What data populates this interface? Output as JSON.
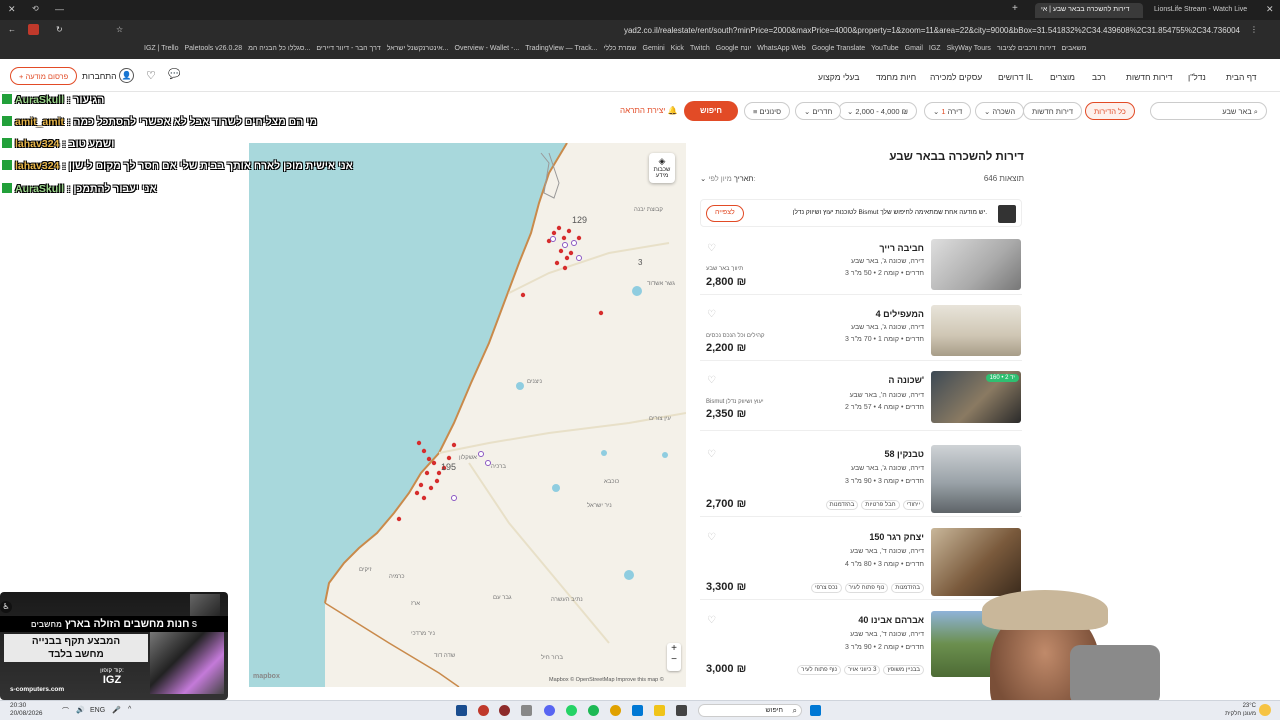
{
  "browser": {
    "tabs": [
      {
        "label": "דירות להשכרה בבאר שבע | אי"
      },
      {
        "label": "LionsLife Stream - Watch Live"
      }
    ],
    "url": "yad2.co.il/realestate/rent/south?minPrice=2000&maxPrice=4000&property=1&zoom=11&area=22&city=9000&bBox=31.541832%2C34.439608%2C31.854755%2C34.736004",
    "bookmarks": [
      "IGZ | Trello",
      "Paletools v26.0.28",
      "סגללו כל הבניה המ...",
      "דרך הבר - דיוור דיירים",
      "אינטרנקשנל ישראל...",
      "Overview - Wallet -...",
      "TradingView — Track...",
      "שמרת כללי",
      "Gemini",
      "Kick",
      "Twitch",
      "Google יונח",
      "WhatsApp Web",
      "Google Translate",
      "YouTube",
      "Gmail",
      "IGZ",
      "SkyWay Tours",
      "דירות ורכבים לציבור",
      "משאבים"
    ]
  },
  "header": {
    "post_ad": "+ פרסום מודעה",
    "login": "התחברות",
    "nav": [
      "דף הבית",
      "נדל\"ן",
      "דירות חדשות",
      "רכב",
      "מוצרים",
      "דרושים IL",
      "עסקים למכירה",
      "חיות מחמד",
      "בעלי מקצוע"
    ]
  },
  "filters": {
    "search_value": "באר שבע",
    "all_apartments": "כל הדירות",
    "new_apartments": "דירות חדשות",
    "rent": "השכרה",
    "property": "דירה",
    "property_count": "1",
    "price": "2,000 - 4,000 ₪",
    "rooms": "חדרים",
    "advanced": "סינונים",
    "search_button": "חיפוש",
    "create_alert": "יצירת התראה"
  },
  "map": {
    "layers_label": "שכבות מידע",
    "attribution": "Mapbox © OpenStreetMap Improve this map ©",
    "logo": "mapbox",
    "zoom_in": "+",
    "zoom_out": "−",
    "place_labels": [
      "קבוצת יבנה",
      "גשר אשדוד",
      "ניצנים",
      "עין צורים",
      "אשקלון",
      "ברכיה",
      "כוכבא",
      "ניר ישראל",
      "זיקים",
      "כרמיה",
      "נתיב העשרה",
      "ארז",
      "גבר עם",
      "ניר מרדכי",
      "שדה דוד",
      "ברור חיל"
    ],
    "cluster_labels": [
      "129",
      "195",
      "3"
    ]
  },
  "results": {
    "title": "דירות להשכרה בבאר שבע",
    "count": "646 תוצאות",
    "sort_label": "מיון לפי:",
    "sort_value": "תאריך",
    "promo_text": "לטוכנות יעוץ ושיווק נדלן Bismut יש מודעה אחת שמתאימה לחיפוש שלך.",
    "promo_button": "לצפייה",
    "listings": [
      {
        "title": "חביבה רייך",
        "sub": "דירה, שכונה ג', באר שבע",
        "details": "3 חדרים • קומה 2 • 50 מ\"ר",
        "price": "2,800 ₪",
        "agency": "תיווך באר שבע",
        "badge": "",
        "tags": []
      },
      {
        "title": "המעפילים 4",
        "sub": "דירה, שכונה ג', באר שבע",
        "details": "3 חדרים • קומה 1 • 70 מ\"ר",
        "price": "2,200 ₪",
        "agency": "קהילים וכל הנכס נכסים",
        "badge": "",
        "tags": []
      },
      {
        "title": "שכונה ה'",
        "sub": "דירה, שכונה ה', באר שבע",
        "details": "2 חדרים • קומה 4 • 57 מ\"ר",
        "price": "2,350 ₪",
        "agency": "Bismut יעוץ ושיווק נדלן",
        "badge": "יד 2 • 160",
        "tags": []
      },
      {
        "title": "טבנקין 58",
        "sub": "דירה, שכונה ג', באר שבע",
        "details": "3 חדרים • קומה 3 • 90 מ\"ר",
        "price": "2,700 ₪",
        "agency": "",
        "badge": "",
        "tags": [
          "בהזדמנות",
          "חבל פרטיות",
          "ייחודי"
        ]
      },
      {
        "title": "יצחק רגר 150",
        "sub": "דירה, שכונה ד', באר שבע",
        "details": "4 חדרים • קומה 3 • 80 מ\"ר",
        "price": "3,300 ₪",
        "agency": "",
        "badge": "",
        "tags": [
          "נכס צרפי",
          "נוף פתוח לעיר",
          "בהזדמנות"
        ]
      },
      {
        "title": "אברהם אבינו 40",
        "sub": "דירה, שכונה ד', באר שבע",
        "details": "3 חדרים • קומה 2 • 90 מ\"ר",
        "price": "3,000 ₪",
        "agency": "",
        "badge": "",
        "tags": [
          "נוף פתוח לעיר",
          "3 כיווני אויר",
          "בבניין משופץ"
        ]
      }
    ]
  },
  "chat": [
    {
      "user": "AuraSkull",
      "text": "הגיעור",
      "color": "#9ad48a"
    },
    {
      "user": "amit_amit",
      "text": "מי הם מצליחים לשרוד אבל לא אפשרי להסתכל כמה",
      "color": "#e8b64a"
    },
    {
      "user": "lahav324",
      "text": "ושמע טוב",
      "color": "#e8b64a"
    },
    {
      "user": "lahav324",
      "text": "אני אישית מוכן לארח אותך בבית שלי אם חסר לך מקום לישון",
      "color": "#e8b64a"
    },
    {
      "user": "AuraSkull",
      "text": "אני יעבור להתמכן",
      "color": "#9ad48a"
    }
  ],
  "ad": {
    "headline": "חנות מחשבים הזולה בארץ",
    "brand": "מחשבים S",
    "line1": "המבצע תקף בבנייה",
    "line2": "מחשב בלבד",
    "coupon_label": "קוד קופון:",
    "coupon_code": "IGZ",
    "site": "s-computers.com"
  },
  "taskbar": {
    "time": "20:30",
    "date": "20/08/2026",
    "lang": "ENG",
    "search": "חיפוש",
    "weather_temp": "23°C",
    "weather_desc": "מעונן חלקית"
  }
}
